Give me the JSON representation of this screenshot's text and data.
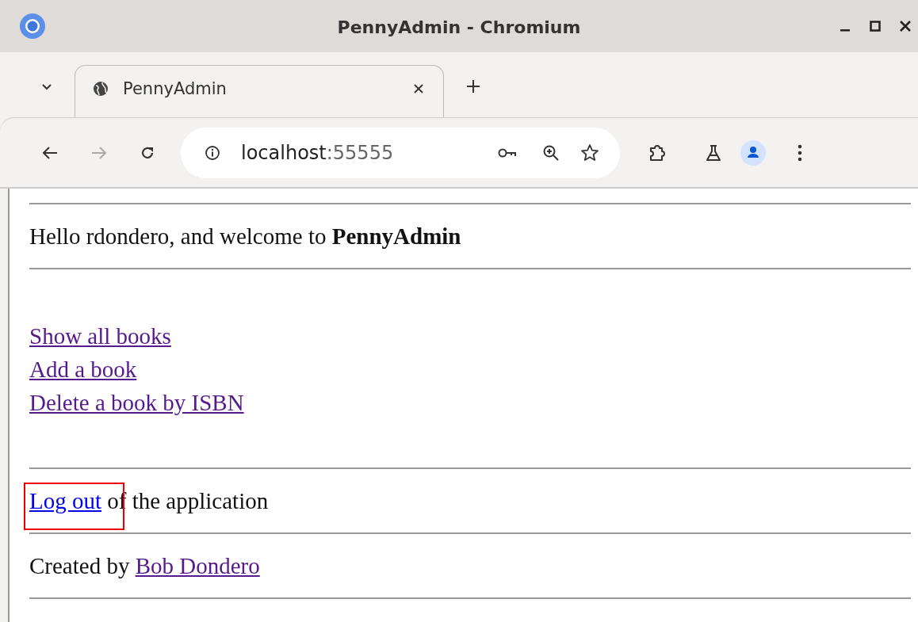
{
  "window": {
    "title": "PennyAdmin - Chromium"
  },
  "tabs": [
    {
      "title": "PennyAdmin",
      "selected": true
    }
  ],
  "address_bar": {
    "host": "localhost",
    "port": ":55555"
  },
  "page": {
    "greeting": "Hello rdondero, and welcome to **PennyAdmin**",
    "links": [
      {
        "label": "Show all books",
        "visited": true
      },
      {
        "label": "Add a book",
        "visited": true
      },
      {
        "label": "Delete a book by ISBN",
        "visited": true
      }
    ],
    "logout": {
      "link": "Log out",
      "visited": false,
      "highlighted": true,
      "text": "of the application"
    },
    "footer": {
      "text": "Created by",
      "link": "Bob Dondero",
      "visited": true
    }
  }
}
